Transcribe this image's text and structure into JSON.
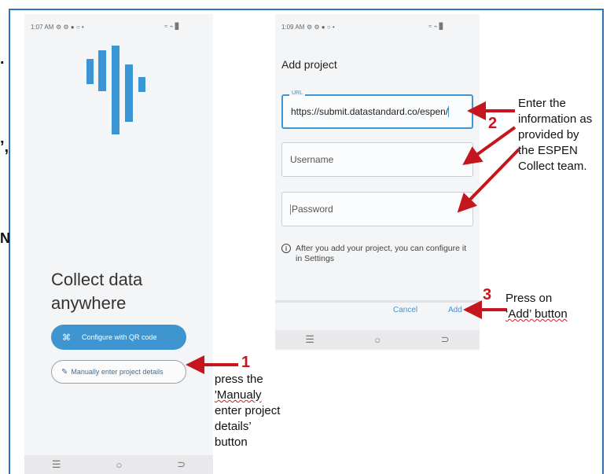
{
  "edge_fragments": [
    ".",
    "’,",
    "N"
  ],
  "screen1": {
    "status_time": "1:07 AM",
    "status_icons": "⚙ ⚙ ● ○ •",
    "status_right": "≈ ⌁ ▊",
    "headline_line1": "Collect data",
    "headline_line2": "anywhere",
    "qr_button_label": "Configure with QR code",
    "manual_button_label": "Manually enter project details",
    "nav": [
      "☰",
      "○",
      "⊃"
    ]
  },
  "screen2": {
    "status_time": "1:09 AM",
    "status_icons": "⚙ ⚙ ● ○ •",
    "status_right": "≈ ⌁ ▊",
    "title": "Add project",
    "url_label": "URL",
    "url_value": "https://submit.datastandard.co/espen/",
    "username_placeholder": "Username",
    "password_placeholder": "Password",
    "info_text": "After you add your project, you can configure it in Settings",
    "cancel_label": "Cancel",
    "add_label": "Add",
    "nav": [
      "☰",
      "○",
      "⊃"
    ]
  },
  "annotations": {
    "step1_number": "1",
    "step1_lines": [
      "press the",
      "'Manualy",
      "enter project",
      "details’",
      "button"
    ],
    "step2_number": "2",
    "step2_lines": [
      "Enter the",
      "information as",
      "provided by",
      "the ESPEN",
      "Collect team."
    ],
    "step3_number": "3",
    "step3_lines": [
      "Press on",
      "‘Add’ button"
    ]
  },
  "colors": {
    "frame": "#2f73b6",
    "accent": "#3f95d0",
    "arrow": "#c4161c"
  }
}
